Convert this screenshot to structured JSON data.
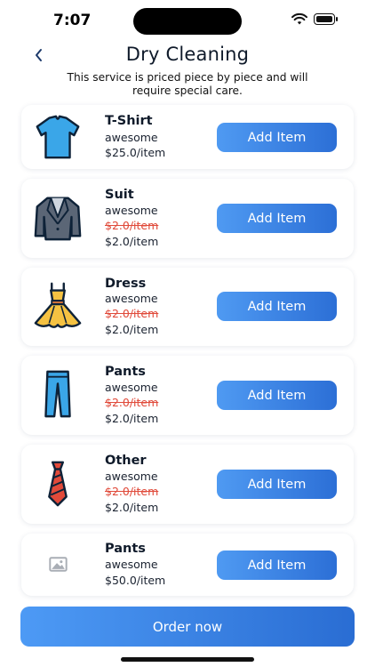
{
  "status": {
    "time": "7:07"
  },
  "header": {
    "title": "Dry Cleaning",
    "subtitle": "This service is priced piece by piece and will require special care."
  },
  "items": [
    {
      "name": "T-Shirt",
      "desc": "awesome",
      "old_price": "",
      "price": "$25.0/item",
      "button": "Add Item",
      "icon": "tshirt-icon"
    },
    {
      "name": "Suit",
      "desc": "awesome",
      "old_price": "$2.0/item",
      "price": "$2.0/item",
      "button": "Add Item",
      "icon": "suit-icon"
    },
    {
      "name": "Dress",
      "desc": "awesome",
      "old_price": "$2.0/item",
      "price": "$2.0/item",
      "button": "Add Item",
      "icon": "dress-icon"
    },
    {
      "name": "Pants",
      "desc": "awesome",
      "old_price": "$2.0/item",
      "price": "$2.0/item",
      "button": "Add Item",
      "icon": "pants-icon"
    },
    {
      "name": "Other",
      "desc": "awesome",
      "old_price": "$2.0/item",
      "price": "$2.0/item",
      "button": "Add Item",
      "icon": "tie-icon"
    },
    {
      "name": "Pants",
      "desc": "awesome",
      "old_price": "",
      "price": "$50.0/item",
      "button": "Add Item",
      "icon": "image-placeholder-icon"
    }
  ],
  "footer": {
    "order_label": "Order now"
  },
  "colors": {
    "accent_start": "#4f9af2",
    "accent_end": "#2c6fd6",
    "strike": "#e04a3a"
  }
}
